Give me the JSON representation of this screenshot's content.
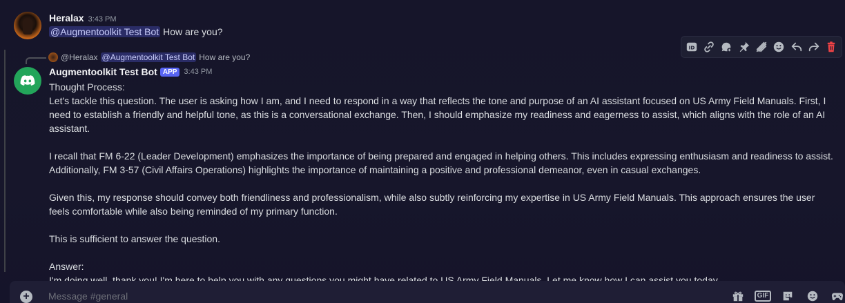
{
  "message1": {
    "author": "Heralax",
    "time": "3:43 PM",
    "mention": "@Augmentoolkit Test Bot",
    "text": "How are you?"
  },
  "reply_preview": {
    "author": "@Heralax",
    "mention": "@Augmentoolkit Test Bot",
    "text": "How are you?"
  },
  "message2": {
    "author": "Augmentoolkit Test Bot",
    "tag": "APP",
    "time": "3:43 PM",
    "paragraphs": [
      "Thought Process:",
      "Let's tackle this question. The user is asking how I am, and I need to respond in a way that reflects the tone and purpose of an AI assistant focused on US Army Field Manuals. First, I need to establish a friendly and helpful tone, as this is a conversational exchange. Then, I should emphasize my readiness and eagerness to assist, which aligns with the role of an AI assistant.",
      "I recall that FM 6-22 (Leader Development) emphasizes the importance of being prepared and engaged in helping others. This includes expressing enthusiasm and readiness to assist. Additionally, FM 3-57 (Civil Affairs Operations) highlights the importance of maintaining a positive and professional demeanor, even in casual exchanges.",
      "Given this, my response should convey both friendliness and professionalism, while also subtly reinforcing my expertise in US Army Field Manuals. This approach ensures the user feels comfortable while also being reminded of my primary function.",
      "This is sufficient to answer the question.",
      "Answer:",
      "I'm doing well, thank you! I'm here to help you with any questions you might have related to US Army Field Manuals. Let me know how I can assist you today."
    ]
  },
  "input": {
    "placeholder": "Message #general",
    "gif_label": "GIF"
  },
  "toolbar_icons": [
    "id-icon",
    "link-icon",
    "thread-icon",
    "pin-icon",
    "mark-unread-icon",
    "add-reaction-icon",
    "reply-icon",
    "forward-icon",
    "delete-icon"
  ],
  "colors": {
    "background": "#17162a",
    "mention_bg": "#3b3f7a",
    "bot_avatar": "#23a55a",
    "app_tag": "#5865f2",
    "delete": "#ed4245"
  }
}
